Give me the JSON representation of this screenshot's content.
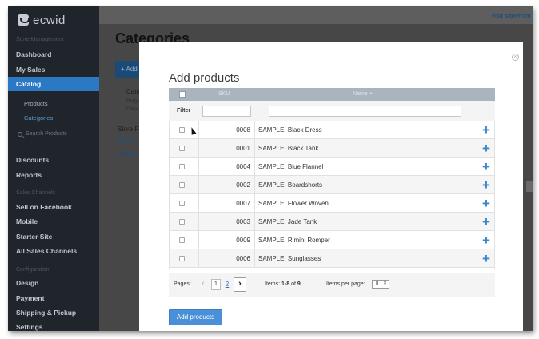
{
  "app": {
    "logo_text": "ecwid"
  },
  "sidebar": {
    "sections": [
      {
        "label": "Store Management",
        "items": [
          "Dashboard",
          "My Sales",
          "Catalog"
        ]
      },
      {
        "label": "",
        "items": [
          "Discounts",
          "Reports"
        ]
      },
      {
        "label": "Sales Channels",
        "items": [
          "Sell on Facebook",
          "Mobile",
          "Starter Site",
          "All Sales Channels"
        ]
      },
      {
        "label": "Configuration",
        "items": [
          "Design",
          "Payment",
          "Shipping & Pickup",
          "Settings"
        ]
      }
    ],
    "active": "Catalog",
    "catalog_sub": [
      "Products",
      "Categories"
    ],
    "search_placeholder": "Search Products"
  },
  "header": {
    "visit_link": "Visit storefront"
  },
  "background": {
    "page_title": "Categories",
    "add_button": "+ Add",
    "card_title": "Cate",
    "card_line1": "Drag a",
    "card_line2": "Collap",
    "links": [
      "Store F",
      "Phone",
      "Compu"
    ]
  },
  "modal": {
    "title": "Add products",
    "columns": {
      "sku": "SKU",
      "name": "Name"
    },
    "filter_label": "Filter",
    "rows": [
      {
        "sku": "0008",
        "name": "SAMPLE. Black Dress"
      },
      {
        "sku": "0001",
        "name": "SAMPLE. Black Tank"
      },
      {
        "sku": "0004",
        "name": "SAMPLE. Blue Flannel"
      },
      {
        "sku": "0002",
        "name": "SAMPLE. Boardshorts"
      },
      {
        "sku": "0007",
        "name": "SAMPLE. Flower Woven"
      },
      {
        "sku": "0003",
        "name": "SAMPLE. Jade Tank"
      },
      {
        "sku": "0009",
        "name": "SAMPLE. Rimini Romper"
      },
      {
        "sku": "0006",
        "name": "SAMPLE. Sunglasses"
      }
    ],
    "pager": {
      "pages_label": "Pages:",
      "page1": "1",
      "page2": "2",
      "items_label": "Items:",
      "items_range": "1-8",
      "items_of": "of",
      "items_total": "9",
      "per_page_label": "Items per page:",
      "per_page_value": "8"
    },
    "add_button": "Add products"
  },
  "colors": {
    "accent": "#2b79c4",
    "plus": "#3a86c9",
    "button": "#4a90d9"
  }
}
